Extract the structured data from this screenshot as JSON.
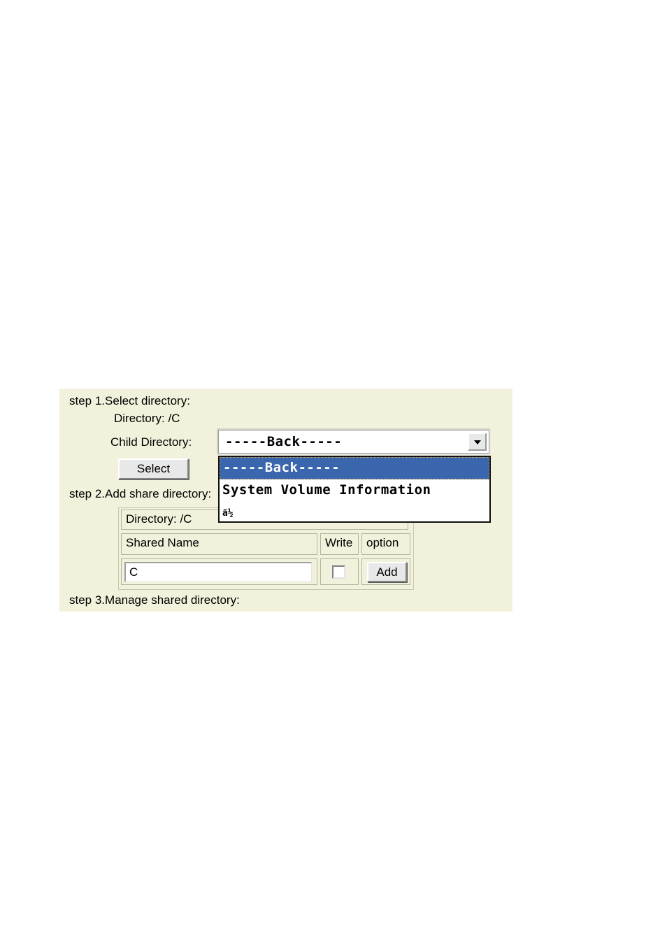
{
  "panel": {
    "background_color": "#f2f2dc",
    "step1_label": "step 1.Select directory:",
    "directory_label": "Directory: /C",
    "child_directory_label": "Child Directory:",
    "select_button_label": "Select",
    "step2_label": "step 2.Add share directory:",
    "step3_label": "step 3.Manage shared directory:"
  },
  "child_directory_select": {
    "selected_value": "-----Back-----",
    "dropdown_open": true,
    "highlight_color": "#3a66ad",
    "focus_outline_color": "#e0a84a",
    "options": [
      {
        "label": "-----Back-----",
        "selected": true
      },
      {
        "label": "System Volume Information",
        "selected": false
      },
      {
        "label": "ä½",
        "selected": false
      }
    ]
  },
  "share_table": {
    "directory_row_label": "Directory: /C",
    "columns": [
      "Shared Name",
      "Write",
      "option"
    ],
    "rows": [
      {
        "shared_name_value": "C",
        "shared_name_placeholder": "",
        "write_checked": false,
        "option_button_label": "Add"
      }
    ]
  }
}
